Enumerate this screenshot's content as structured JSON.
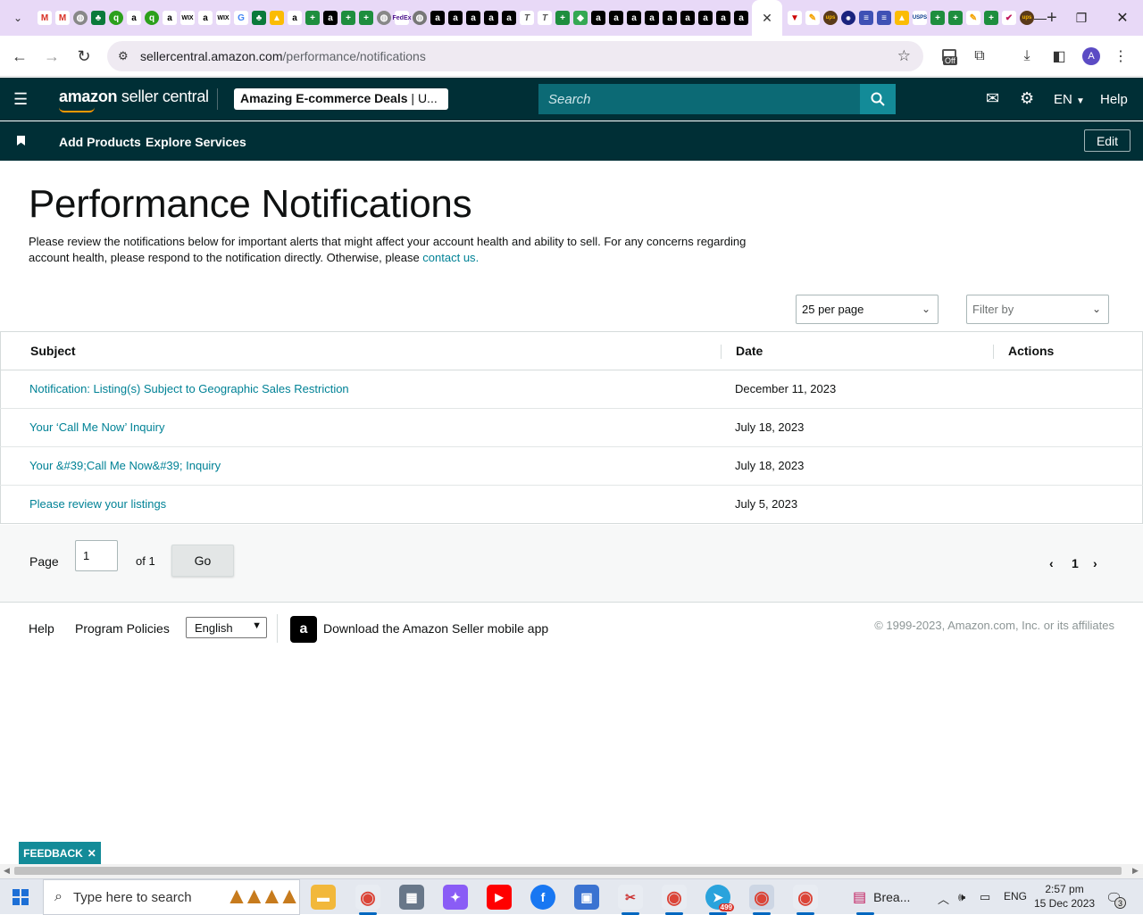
{
  "browser": {
    "active_tab_close": "✕",
    "new_tab": "+",
    "url_host": "sellercentral.amazon.com",
    "url_path": "/performance/notifications",
    "profile_initial": "A",
    "ext_badge": "Off"
  },
  "header": {
    "logo_bold": "amazon",
    "logo_rest": " seller central",
    "store_bold": "Amazing E-commerce Deals",
    "store_rest": " | U...",
    "search_placeholder": "Search",
    "lang": "EN",
    "help": "Help"
  },
  "nav": {
    "add_products": "Add Products",
    "explore_services": "Explore Services",
    "edit": "Edit"
  },
  "page": {
    "title": "Performance Notifications",
    "intro": "Please review the notifications below for important alerts that might affect your account health and ability to sell. For any concerns regarding account health, please respond to the notification directly. Otherwise, please ",
    "contact_link": "contact us",
    "intro_end": "."
  },
  "controls": {
    "per_page": "25 per page",
    "filter_by": "Filter by"
  },
  "table": {
    "headers": [
      "Subject",
      "Date",
      "Actions"
    ],
    "rows": [
      {
        "subject": "Notification: Listing(s) Subject to Geographic Sales Restriction",
        "date": "December 11, 2023"
      },
      {
        "subject": "Your ‘Call Me Now’ Inquiry",
        "date": "July 18, 2023"
      },
      {
        "subject": "Your &#39;Call Me Now&#39; Inquiry",
        "date": "July 18, 2023"
      },
      {
        "subject": "Please review your listings",
        "date": "July 5, 2023"
      }
    ]
  },
  "pager": {
    "page_label": "Page",
    "page_value": "1",
    "of_label": "of 1",
    "go": "Go",
    "current": "1"
  },
  "footer": {
    "help": "Help",
    "program_policies": "Program Policies",
    "language": "English",
    "download_app": "Download the Amazon Seller mobile app",
    "copyright": "© 1999-2023, Amazon.com, Inc. or its affiliates"
  },
  "feedback": "FEEDBACK",
  "taskbar": {
    "search_placeholder": "Type here to search",
    "window_label": "Brea...",
    "telegram_badge": "499",
    "lang": "ENG",
    "time": "2:57 pm",
    "date": "15 Dec 2023",
    "notif_count": "3"
  },
  "colors": {
    "header_bg": "#002f36",
    "link": "#008296",
    "search_btn": "#138b98"
  }
}
